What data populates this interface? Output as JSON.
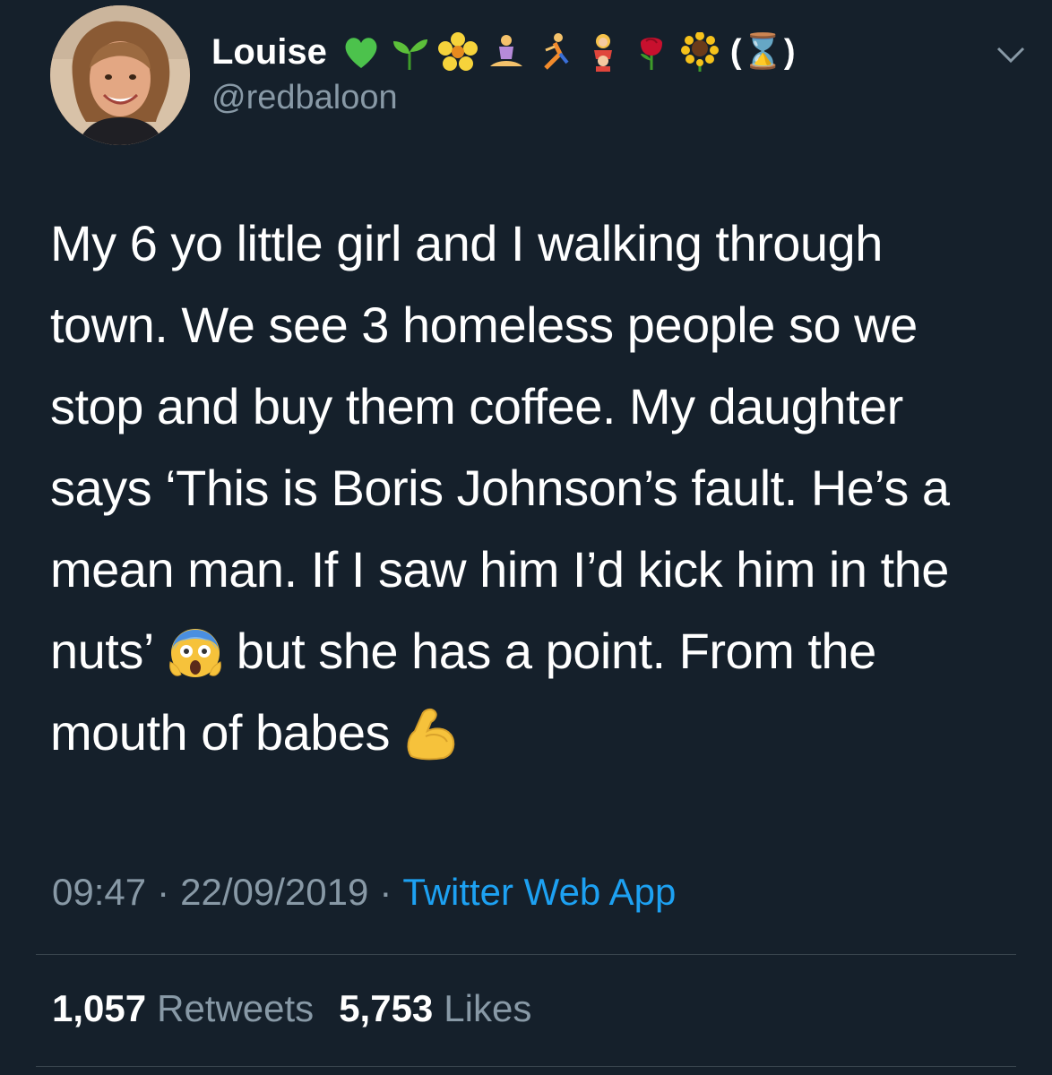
{
  "author": {
    "display_name": "Louise",
    "name_suffix": "(⌛)",
    "handle": "@redbaloon",
    "name_emojis": [
      "green-heart",
      "seedling",
      "blossom",
      "person-in-lotus",
      "person-running",
      "woman-and-girl",
      "rose",
      "sunflower"
    ]
  },
  "tweet": {
    "lines": [
      "My 6 yo little girl and I walking through",
      "town. We see 3 homeless people so we",
      "stop and buy them coffee. My daughter",
      "says ‘This is Boris Johnson’s fault. He’s a",
      "mean man. If I saw him I’d kick him in the"
    ],
    "line6_before": "nuts’",
    "line6_emoji": "face-screaming-in-fear",
    "line6_after": "but she has a point. From the",
    "line7_before": "mouth of babes",
    "line7_emoji": "flexed-biceps"
  },
  "meta": {
    "time": "09:47",
    "separator": "·",
    "date": "22/09/2019",
    "source": "Twitter Web App",
    "source_color": "#1da1f2"
  },
  "stats": {
    "retweets_count": "1,057",
    "retweets_label": "Retweets",
    "likes_count": "5,753",
    "likes_label": "Likes"
  },
  "colors": {
    "background": "#15202b",
    "secondary_text": "#8899a6",
    "divider": "#38444d"
  }
}
